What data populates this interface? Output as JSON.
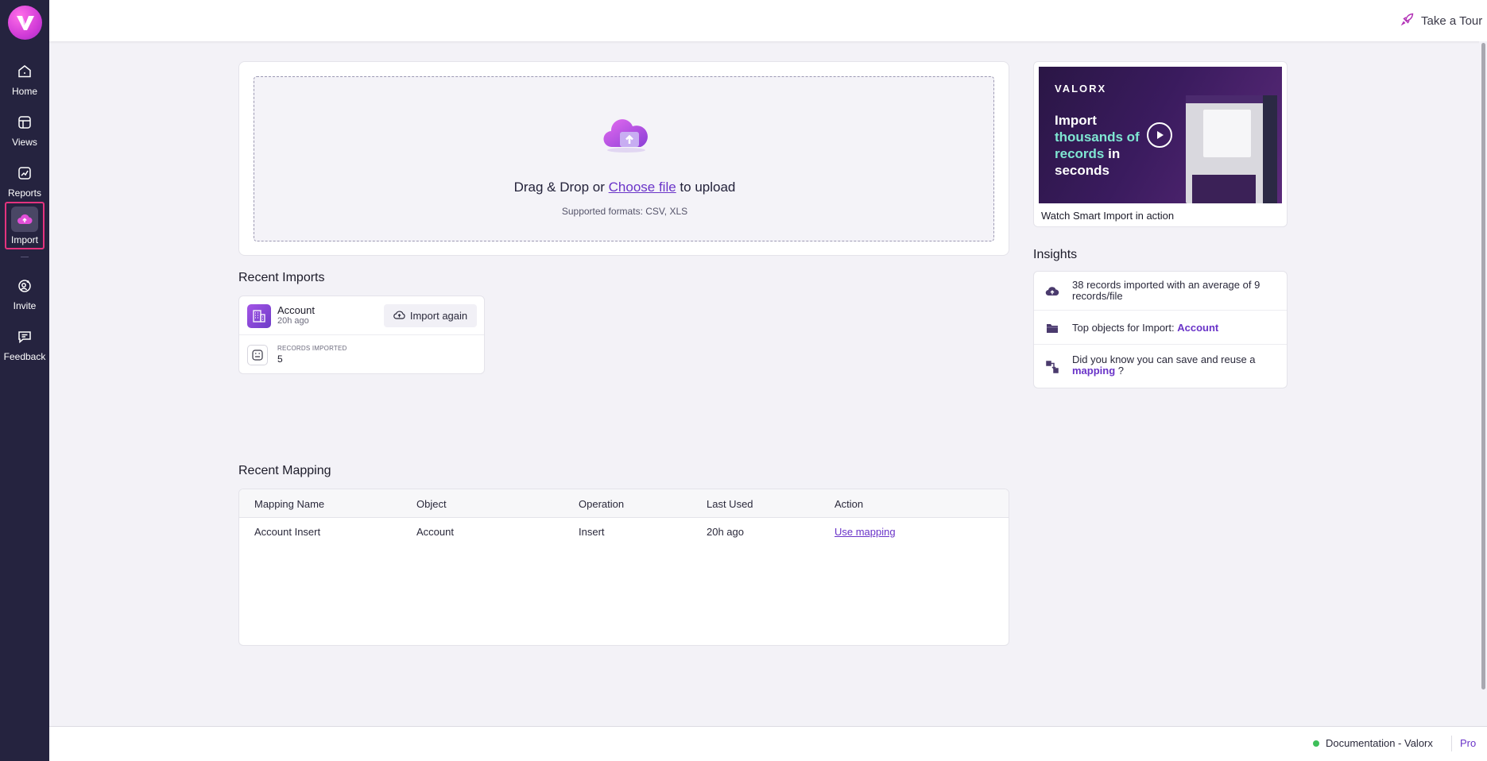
{
  "sidebar": {
    "items": [
      {
        "label": "Home",
        "icon": "home-icon"
      },
      {
        "label": "Views",
        "icon": "views-icon"
      },
      {
        "label": "Reports",
        "icon": "reports-icon"
      },
      {
        "label": "Import",
        "icon": "import-icon",
        "active": true
      },
      {
        "label": "Invite",
        "icon": "invite-icon"
      },
      {
        "label": "Feedback",
        "icon": "feedback-icon"
      }
    ]
  },
  "header": {
    "tour_label": "Take a Tour"
  },
  "upload": {
    "prefix": "Drag & Drop or ",
    "choose_label": "Choose file",
    "suffix": " to upload",
    "formats": "Supported formats: CSV, XLS"
  },
  "recent_imports": {
    "title": "Recent Imports",
    "items": [
      {
        "object": "Account",
        "time": "20h ago",
        "action": "Import again",
        "records_label": "RECORDS IMPORTED",
        "records": "5"
      }
    ]
  },
  "recent_mapping": {
    "title": "Recent Mapping",
    "columns": [
      "Mapping Name",
      "Object",
      "Operation",
      "Last Used",
      "Action"
    ],
    "rows": [
      {
        "name": "Account Insert",
        "object": "Account",
        "operation": "Insert",
        "last_used": "20h ago",
        "action": "Use mapping"
      }
    ]
  },
  "video": {
    "brand": "VALORX",
    "headline_1": "Import",
    "headline_hl": "thousands of records",
    "headline_2": "in seconds",
    "caption": "Watch Smart Import in action"
  },
  "insights": {
    "title": "Insights",
    "items": [
      {
        "text": "38 records imported with an average of 9 records/file"
      },
      {
        "text": "Top objects for Import: ",
        "bold": "Account"
      },
      {
        "text": "Did you know you can save and reuse a ",
        "bold": "mapping",
        "after": " ?"
      }
    ]
  },
  "footer": {
    "doc_label": "Documentation - Valorx",
    "pro_label": "Pro"
  },
  "colors": {
    "sidebar": "#25233f",
    "accent": "#6a34c8",
    "active_border": "#e4337e",
    "status_ok": "#3ebf5a"
  }
}
